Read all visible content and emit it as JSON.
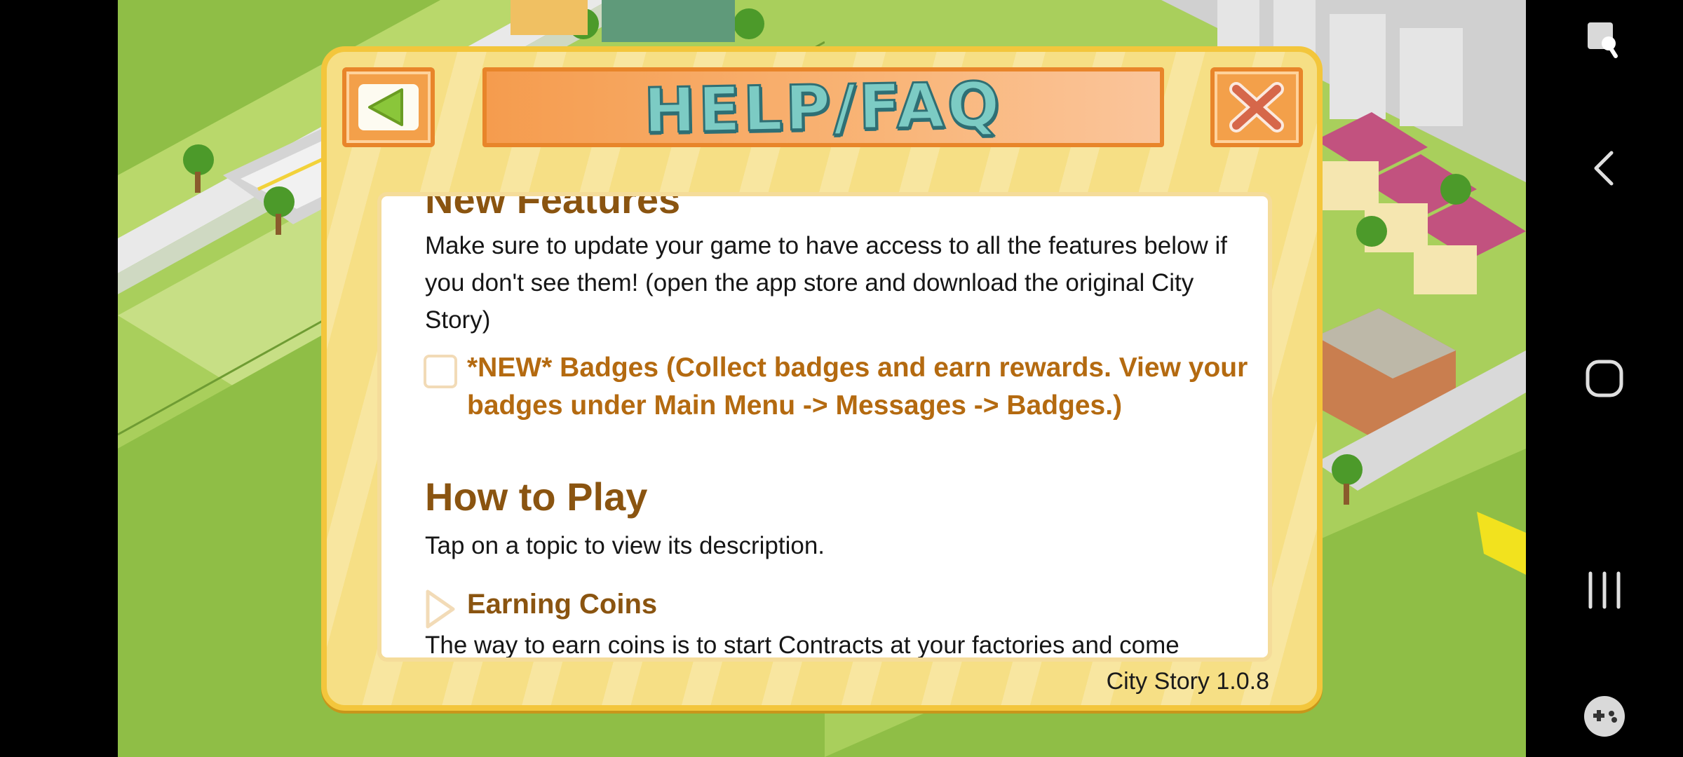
{
  "dialog": {
    "title": "HELP/FAQ",
    "back_icon": "back-arrow-icon",
    "close_icon": "close-x-icon",
    "version": "City Story 1.0.8"
  },
  "content": {
    "clipped_heading": "New Features",
    "intro": "Make sure to update your game to have access to all the features below if you don't see them! (open the app store and download the original City Story)",
    "features": [
      {
        "label": "*NEW* Badges (Collect badges and earn rewards. View your badges under Main Menu -> Messages -> Badges.)"
      }
    ],
    "how_to_play": {
      "heading": "How to Play",
      "subtitle": "Tap on a topic to view its description.",
      "topics": [
        {
          "title": "Earning Coins",
          "expanded": true,
          "text": "The way to earn coins is to start Contracts at your factories and come"
        }
      ]
    }
  },
  "navbar": {
    "icons": [
      "accessibility-icon",
      "back-icon",
      "home-icon",
      "recents-icon",
      "game-tools-icon"
    ]
  },
  "colors": {
    "dialog_bg": "#f6df85",
    "title_text": "#7ccbc4",
    "feature_text": "#b46a10",
    "heading_text": "#8a5410"
  }
}
